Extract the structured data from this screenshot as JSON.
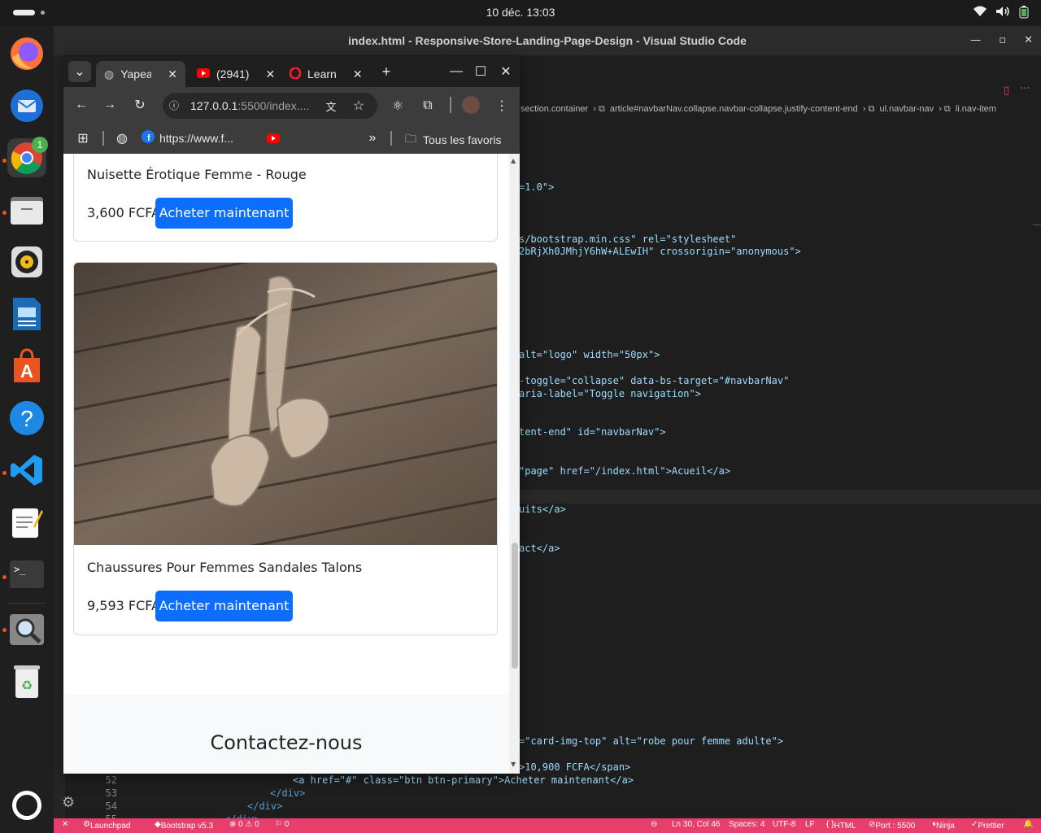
{
  "system": {
    "clock": "10 déc.  13:03",
    "icons": [
      "wifi-icon",
      "volume-icon",
      "battery-icon"
    ]
  },
  "dock": {
    "items": [
      "firefox",
      "thunderbird",
      "chrome",
      "files",
      "rhythmbox",
      "libreoffice-writer",
      "app-center",
      "help",
      "vscode",
      "text-editor",
      "terminal",
      "search",
      "trash"
    ],
    "chrome_badge": "1"
  },
  "vscode": {
    "title": "index.html - Responsive-Store-Landing-Page-Design - Visual Studio Code",
    "breadcrumb": [
      "section.container",
      "article#navbarNav.collapse.navbar-collapse.justify-content-end",
      "ul.navbar-nav",
      "li.nav-item"
    ],
    "code_fragments": [
      {
        "text": "=1.0\">"
      },
      {
        "text": "s/bootstrap.min.css\" rel=\"stylesheet\""
      },
      {
        "text": "2bRjXh0JMhjY6hW+ALEwIH\" crossorigin=\"anonymous\">"
      },
      {
        "text": "alt=\"logo\" width=\"50px\">"
      },
      {
        "text": "-toggle=\"collapse\" data-bs-target=\"#navbarNav\""
      },
      {
        "text": "aria-label=\"Toggle navigation\">"
      },
      {
        "text": "tent-end\" id=\"navbarNav\">"
      },
      {
        "text": "\"page\" href=\"/index.html\">Acueil</a>"
      },
      {
        "text": "uits</a>"
      },
      {
        "text": "act</a>"
      },
      {
        "text": "=\"card-img-top\" alt=\"robe pour femme adulte\">"
      },
      {
        "text": ">10,900 FCFA</span>"
      }
    ],
    "lines": [
      {
        "no": "52",
        "text": "<a href=\"#\" class=\"btn btn-primary\">Acheter maintenant</a>"
      },
      {
        "no": "53",
        "text": "</div>"
      },
      {
        "no": "54",
        "text": "</div>"
      },
      {
        "no": "55",
        "text": "</div>"
      }
    ],
    "status": {
      "remote": "✕",
      "launchpad": "Launchpad",
      "bootstrap": "Bootstrap v5.3",
      "problems": "⊗ 0 ⚠ 0",
      "ports": "⚐ 0",
      "position": "Ln 30, Col 46",
      "spaces": "Spaces: 4",
      "encoding": "UTF-8",
      "eol": "LF",
      "language": "HTML",
      "port": "Port : 5500",
      "ninja": "Ninja",
      "prettier": "Prettier"
    }
  },
  "chrome": {
    "tabs": [
      {
        "label": "Yapea",
        "icon": "globe-icon",
        "active": true
      },
      {
        "label": "(2941)",
        "icon": "youtube-icon",
        "active": false
      },
      {
        "label": "Learn",
        "icon": "opera-icon",
        "active": false
      }
    ],
    "url_host": "127.0.0.1",
    "url_path": ":5500/index....",
    "bookmarks": {
      "facebook": "https://www.f...",
      "all_bookmarks": "Tous les favoris"
    },
    "page": {
      "products": [
        {
          "title": "Nuisette Érotique Femme - Rouge",
          "price": "3,600 FCFA",
          "button": "Acheter maintenant"
        },
        {
          "title": "Chaussures Pour Femmes Sandales Talons",
          "price": "9,593 FCFA",
          "button": "Acheter maintenant"
        }
      ],
      "contact_title": "Contactez-nous"
    }
  }
}
